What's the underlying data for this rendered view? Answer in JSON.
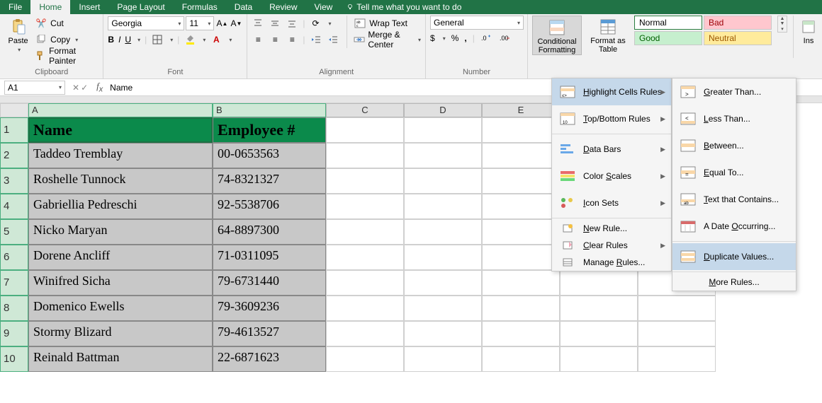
{
  "tabs": {
    "file": "File",
    "home": "Home",
    "insert": "Insert",
    "page_layout": "Page Layout",
    "formulas": "Formulas",
    "data": "Data",
    "review": "Review",
    "view": "View",
    "tell_me": "Tell me what you want to do"
  },
  "ribbon": {
    "clipboard": {
      "label": "Clipboard",
      "paste": "Paste",
      "cut": "Cut",
      "copy": "Copy",
      "format_painter": "Format Painter"
    },
    "font": {
      "label": "Font",
      "name": "Georgia",
      "size": "11"
    },
    "alignment": {
      "label": "Alignment",
      "wrap": "Wrap Text",
      "merge": "Merge & Center"
    },
    "number": {
      "label": "Number",
      "format": "General"
    },
    "styles": {
      "cond_fmt": "Conditional Formatting",
      "fmt_table": "Format as Table",
      "normal": "Normal",
      "bad": "Bad",
      "good": "Good",
      "neutral": "Neutral"
    },
    "insert_btn": "Ins"
  },
  "formula_bar": {
    "cell_ref": "A1",
    "formula": "Name"
  },
  "columns": [
    "A",
    "B",
    "C",
    "D",
    "E"
  ],
  "sheet": {
    "headersCount": 1,
    "columns": [
      {
        "name": "A",
        "header": "Name"
      },
      {
        "name": "B",
        "header": "Employee #"
      }
    ],
    "rows": [
      {
        "Name": "Taddeo Tremblay",
        "Employee #": "00-0653563"
      },
      {
        "Name": "Roshelle Tunnock",
        "Employee #": "74-8321327"
      },
      {
        "Name": "Gabriellia Pedreschi",
        "Employee #": "92-5538706"
      },
      {
        "Name": "Nicko Maryan",
        "Employee #": "64-8897300"
      },
      {
        "Name": "Dorene Ancliff",
        "Employee #": "71-0311095"
      },
      {
        "Name": "Winifred Sicha",
        "Employee #": "79-6731440"
      },
      {
        "Name": "Domenico Ewells",
        "Employee #": "79-3609236"
      },
      {
        "Name": "Stormy Blizard",
        "Employee #": "79-4613527"
      },
      {
        "Name": "Reinald Battman",
        "Employee #": "22-6871623"
      }
    ]
  },
  "menu1": {
    "highlight": "Highlight Cells Rules",
    "topbottom": "Top/Bottom Rules",
    "databars": "Data Bars",
    "colorscales": "Color Scales",
    "iconsets": "Icon Sets",
    "newrule": "New Rule...",
    "clear": "Clear Rules",
    "manage": "Manage Rules..."
  },
  "menu2": {
    "greater": "Greater Than...",
    "less": "Less Than...",
    "between": "Between...",
    "equal": "Equal To...",
    "text": "Text that Contains...",
    "date": "A Date Occurring...",
    "dup": "Duplicate Values...",
    "more": "More Rules..."
  }
}
